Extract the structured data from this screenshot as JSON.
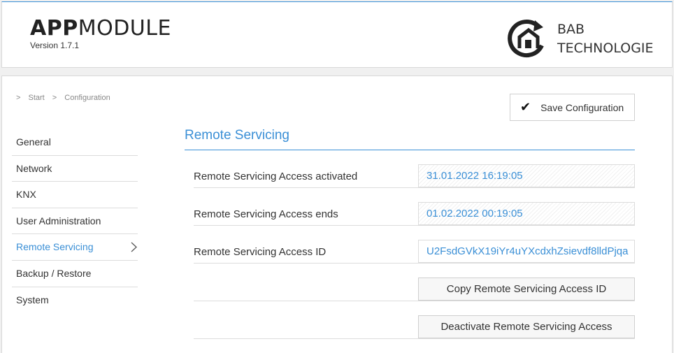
{
  "header": {
    "app_title_bold": "APP",
    "app_title_light": "MODULE",
    "version": "Version 1.7.1",
    "logo_line1": "BAB",
    "logo_line2": "TECHNOLOGIE",
    "logo_icon": "house-circle-arrow-icon"
  },
  "breadcrumb": {
    "sep": ">",
    "items": [
      "Start",
      "Configuration"
    ]
  },
  "toolbar": {
    "save_label": "Save Configuration",
    "save_icon": "checkmark-icon"
  },
  "sidebar": {
    "items": [
      {
        "label": "General"
      },
      {
        "label": "Network"
      },
      {
        "label": "KNX"
      },
      {
        "label": "User Administration"
      },
      {
        "label": "Remote Servicing",
        "active": true
      },
      {
        "label": "Backup / Restore"
      },
      {
        "label": "System"
      }
    ]
  },
  "main": {
    "section_title": "Remote Servicing",
    "rows": [
      {
        "label": "Remote Servicing Access activated",
        "value": "31.01.2022 16:19:05"
      },
      {
        "label": "Remote Servicing Access ends",
        "value": "01.02.2022 00:19:05"
      },
      {
        "label": "Remote Servicing Access ID",
        "value": "U2FsdGVkX19iYr4uYXcdxhZsievdf8lldPjqa"
      }
    ],
    "copy_button": "Copy Remote Servicing Access ID",
    "deactivate_button": "Deactivate Remote Servicing Access"
  },
  "colors": {
    "accent": "#3a8fd6",
    "text": "#333333",
    "border": "#dcdcdc"
  }
}
